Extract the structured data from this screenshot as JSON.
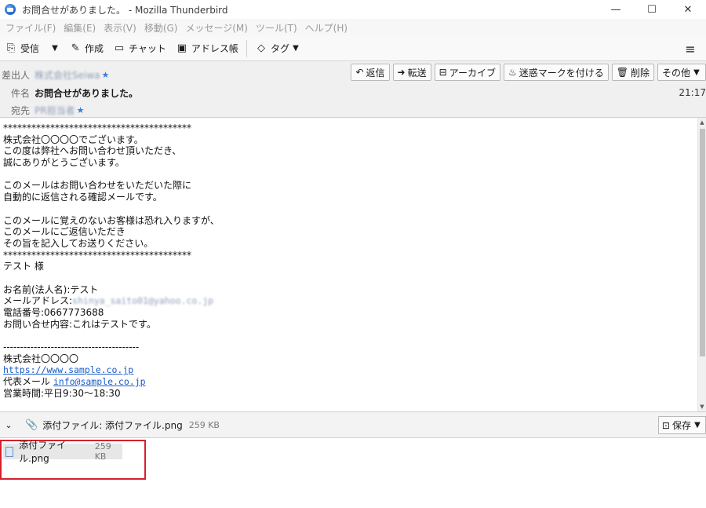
{
  "window": {
    "title": "お問合せがありました。 - Mozilla Thunderbird",
    "minimize_glyph": "—",
    "maximize_glyph": "☐",
    "close_glyph": "✕"
  },
  "menu": [
    "ファイル(F)",
    "編集(E)",
    "表示(V)",
    "移動(G)",
    "メッセージ(M)",
    "ツール(T)",
    "ヘルプ(H)"
  ],
  "toolbar": {
    "receive": "受信",
    "compose": "作成",
    "chat": "チャット",
    "address_book": "アドレス帳",
    "tag": "タグ"
  },
  "header": {
    "from_label": "差出人",
    "from_value": "株式会社Seiwa",
    "subject_label": "件名",
    "subject_value": "お問合せがありました。",
    "to_label": "宛先",
    "to_value": "PR担当者",
    "time": "21:17",
    "actions": {
      "reply": "返信",
      "forward": "転送",
      "archive": "アーカイブ",
      "junk": "迷惑マークを付ける",
      "delete": "削除",
      "other": "その他"
    }
  },
  "body": {
    "lines": [
      "****************************************",
      "株式会社〇〇〇〇でございます。",
      "この度は弊社へお問い合わせ頂いただき、",
      "誠にありがとうございます。",
      "",
      "このメールはお問い合わせをいただいた際に",
      "自動的に返信される確認メールです。",
      "",
      "このメールに覚えのないお客様は恐れ入りますが、",
      "このメールにご返信いただき",
      "その旨を記入してお送りください。",
      "****************************************",
      "テスト 様",
      "",
      "お名前(法人名):テスト",
      "メールアドレス:",
      "電話番号:0667773688",
      "お問い合せ内容:これはテストです。",
      "",
      "----------------------------------------",
      "株式会社〇〇〇〇",
      "https://www.sample.co.jp",
      "代表メール info@sample.co.jp",
      "営業時間:平日9:30～18:30"
    ],
    "email_blurred": "shinya_saito01@yahoo.co.jp",
    "url": "https://www.sample.co.jp",
    "rep_mail_label": "代表メール",
    "rep_mail": "info@sample.co.jp"
  },
  "attachments": {
    "bar_label": "添付ファイル: 添付ファイル.png",
    "bar_size": "259 KB",
    "save_label": "保存",
    "item_name": "添付ファイル.png",
    "item_size": "259 KB"
  },
  "colors": {
    "accent": "#3a7be0",
    "highlight": "#d6202c",
    "link": "#1a5cc8"
  }
}
